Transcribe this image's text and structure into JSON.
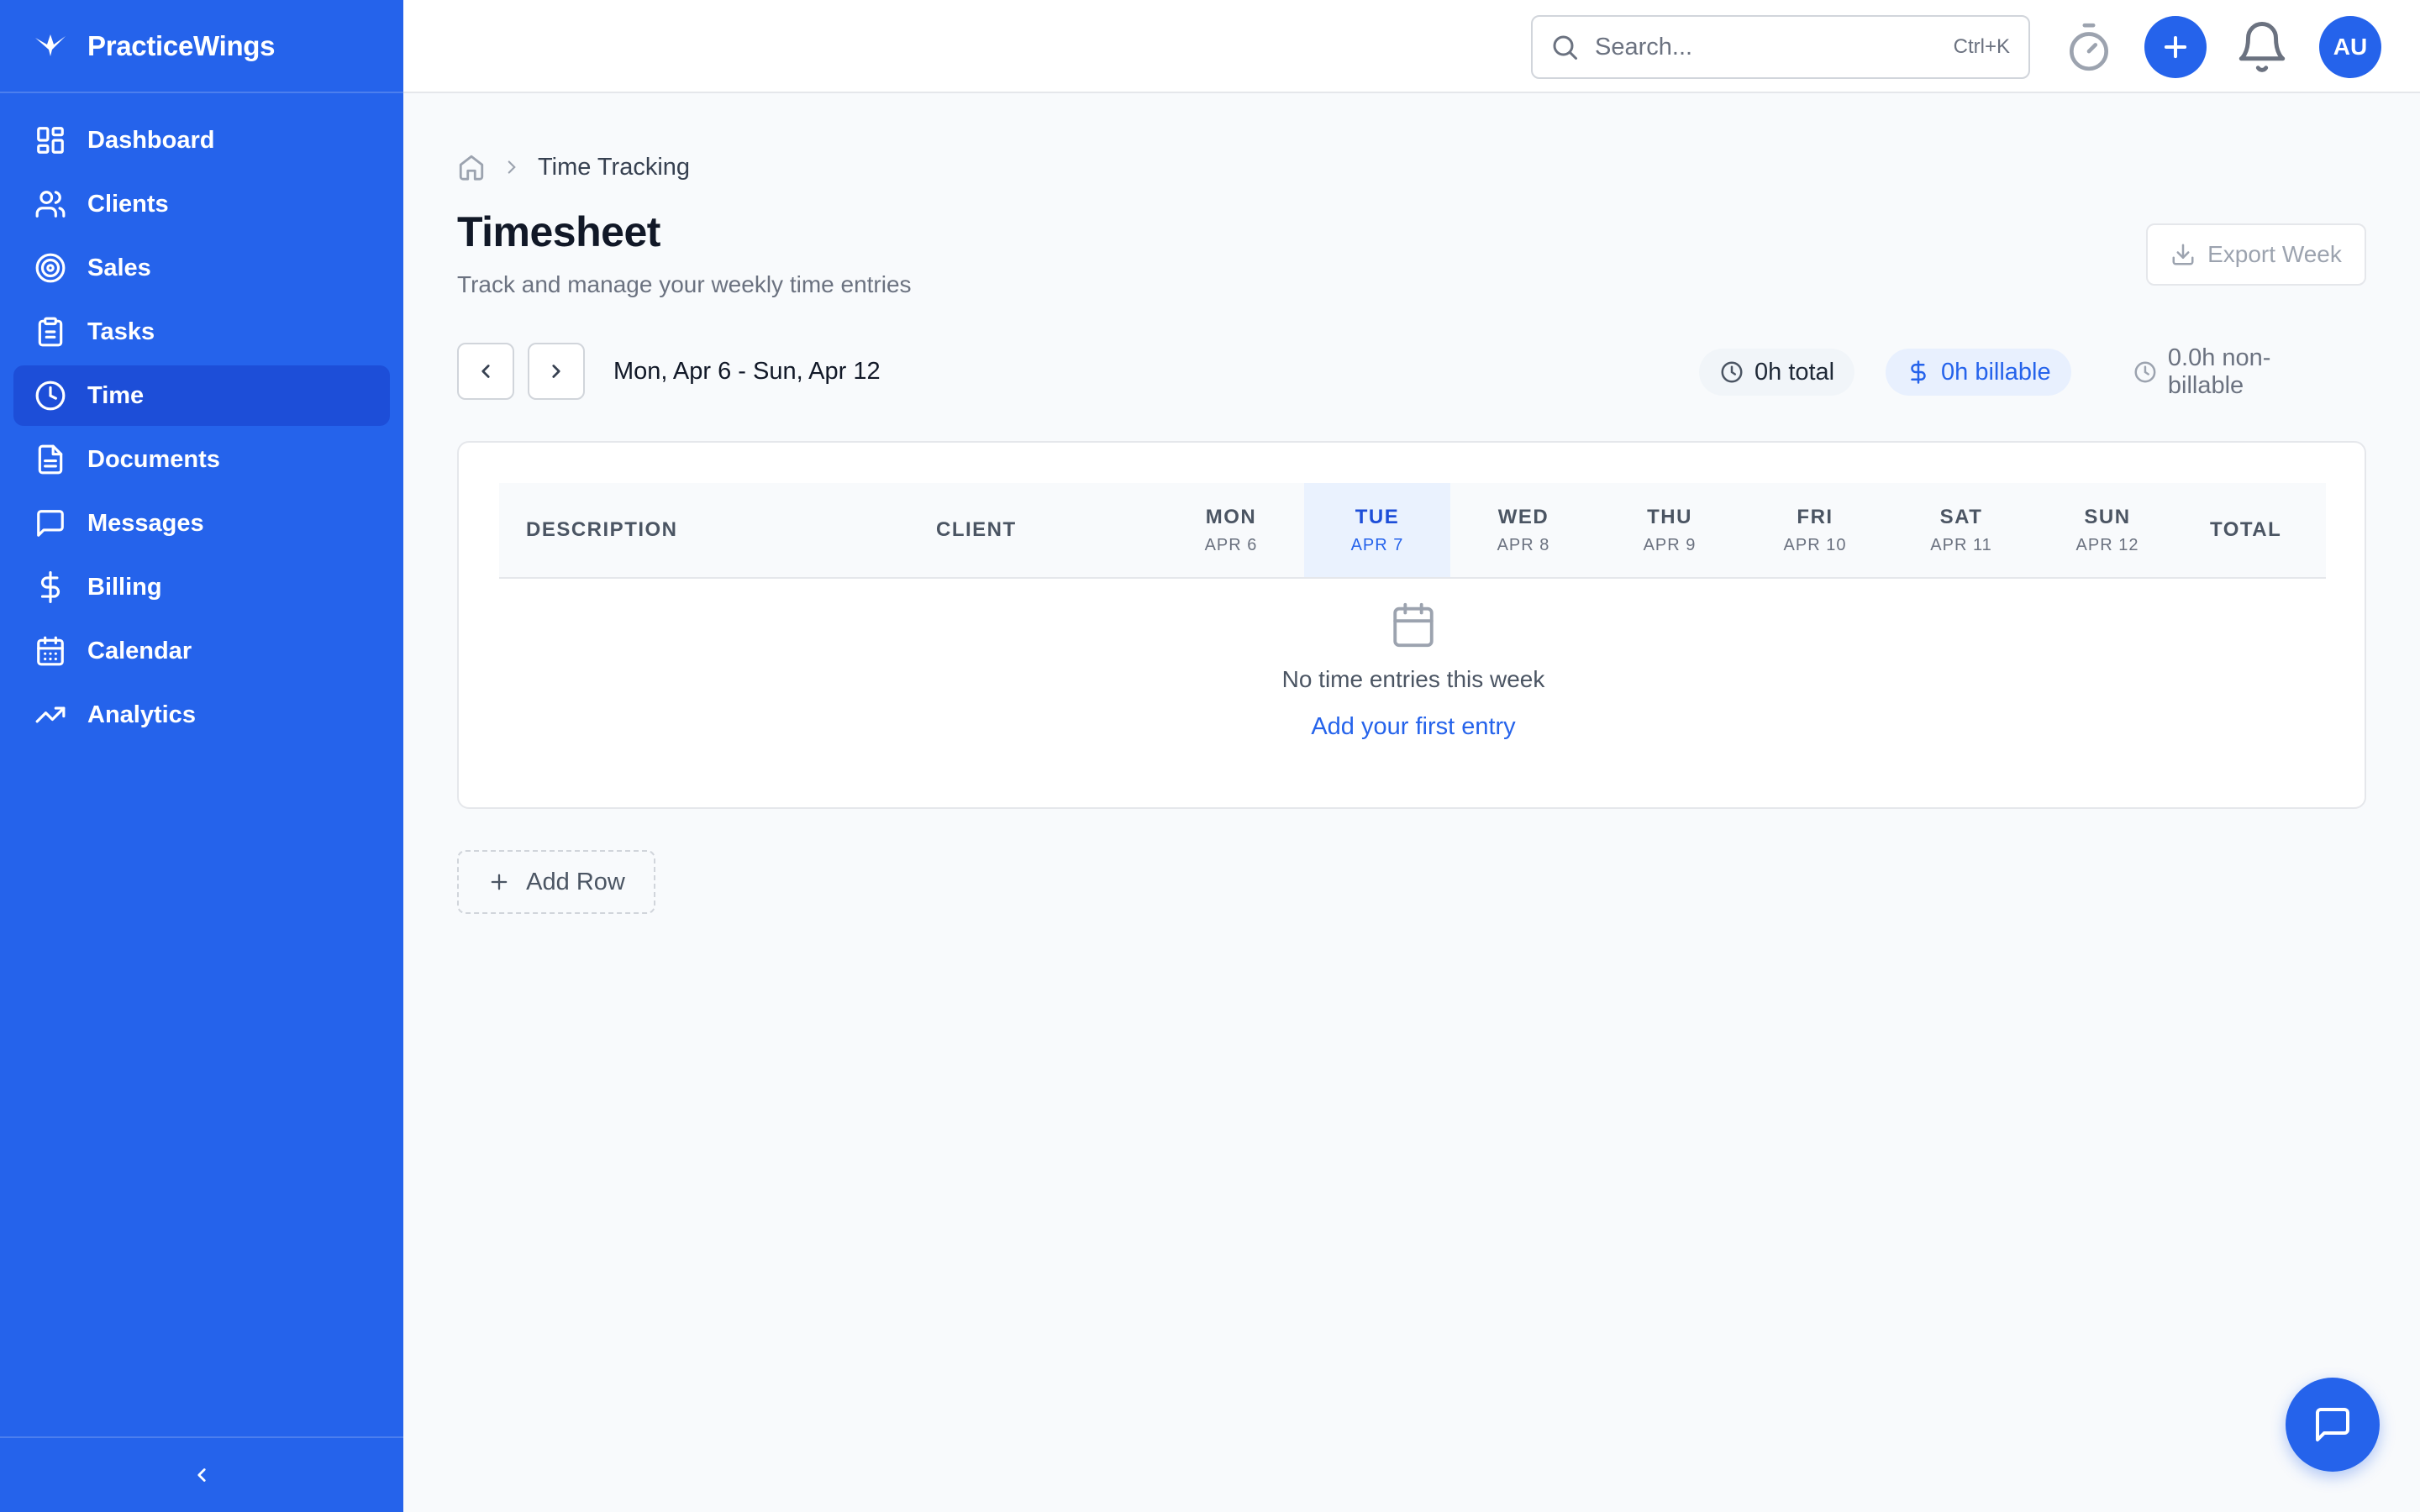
{
  "app": {
    "name": "PracticeWings"
  },
  "sidebar": {
    "items": [
      {
        "label": "Dashboard",
        "icon": "dashboard-icon",
        "active": false
      },
      {
        "label": "Clients",
        "icon": "users-icon",
        "active": false
      },
      {
        "label": "Sales",
        "icon": "target-icon",
        "active": false
      },
      {
        "label": "Tasks",
        "icon": "clipboard-icon",
        "active": false
      },
      {
        "label": "Time",
        "icon": "clock-icon",
        "active": true
      },
      {
        "label": "Documents",
        "icon": "document-icon",
        "active": false
      },
      {
        "label": "Messages",
        "icon": "message-icon",
        "active": false
      },
      {
        "label": "Billing",
        "icon": "dollar-icon",
        "active": false
      },
      {
        "label": "Calendar",
        "icon": "calendar-icon",
        "active": false
      },
      {
        "label": "Analytics",
        "icon": "trending-up-icon",
        "active": false
      }
    ]
  },
  "header": {
    "search": {
      "placeholder": "Search...",
      "shortcut": "Ctrl+K"
    },
    "avatar_initials": "AU"
  },
  "breadcrumb": {
    "current": "Time Tracking"
  },
  "page": {
    "title": "Timesheet",
    "subtitle": "Track and manage your weekly time entries",
    "export_label": "Export Week"
  },
  "week": {
    "range": "Mon, Apr 6 - Sun, Apr 12",
    "total": "0h total",
    "billable": "0h billable",
    "non_billable": "0.0h non-billable"
  },
  "table": {
    "columns": {
      "description": "DESCRIPTION",
      "client": "CLIENT",
      "total": "TOTAL"
    },
    "days": [
      {
        "label": "MON",
        "date": "APR 6",
        "today": false
      },
      {
        "label": "TUE",
        "date": "APR 7",
        "today": true
      },
      {
        "label": "WED",
        "date": "APR 8",
        "today": false
      },
      {
        "label": "THU",
        "date": "APR 9",
        "today": false
      },
      {
        "label": "FRI",
        "date": "APR 10",
        "today": false
      },
      {
        "label": "SAT",
        "date": "APR 11",
        "today": false
      },
      {
        "label": "SUN",
        "date": "APR 12",
        "today": false
      }
    ],
    "empty_text": "No time entries this week",
    "empty_link": "Add your first entry"
  },
  "add_row_label": "Add Row",
  "colors": {
    "brand": "#2563eb",
    "brand_dark": "#1d4ed8",
    "background": "#f8fafc"
  }
}
